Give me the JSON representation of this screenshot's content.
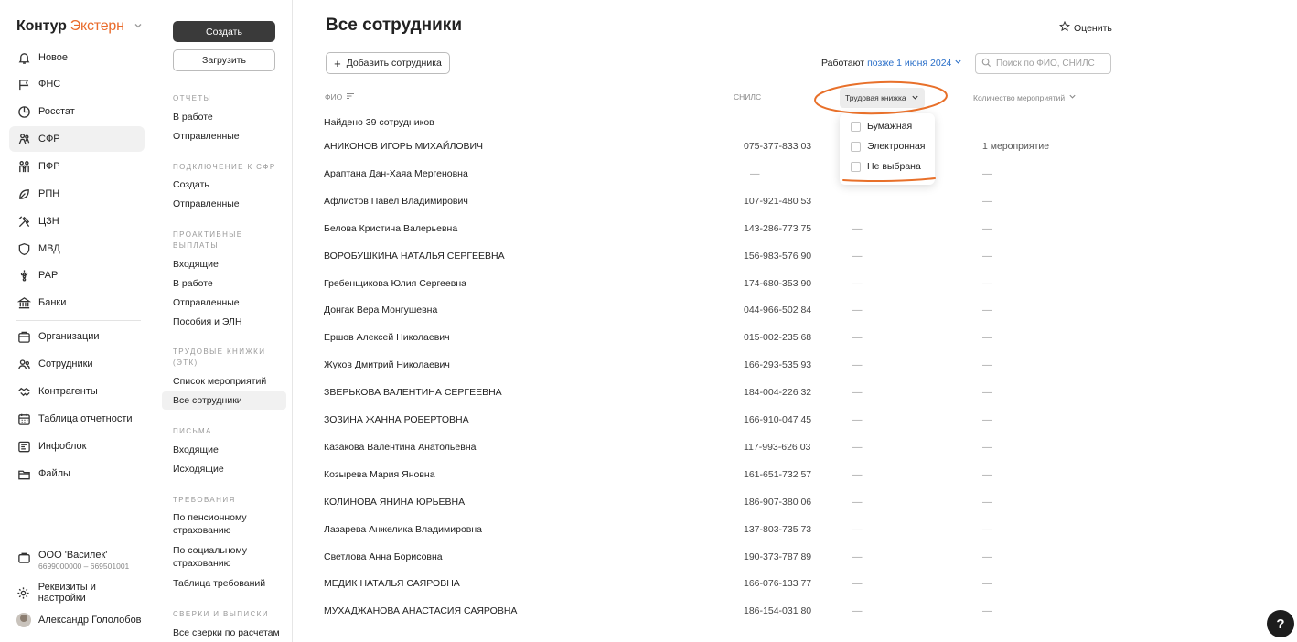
{
  "brand": {
    "part1": "Контур",
    "part2": "Экстерн",
    "chevron": "⌵"
  },
  "nav": {
    "items": [
      {
        "label": "Новое",
        "icon": "bell-icon"
      },
      {
        "label": "ФНС",
        "icon": "flag-icon"
      },
      {
        "label": "Росстат",
        "icon": "chart-circle-icon"
      },
      {
        "label": "СФР",
        "icon": "people-icon"
      },
      {
        "label": "ПФР",
        "icon": "family-icon"
      },
      {
        "label": "РПН",
        "icon": "leaf-icon"
      },
      {
        "label": "ЦЗН",
        "icon": "tools-icon"
      },
      {
        "label": "МВД",
        "icon": "shield-icon"
      },
      {
        "label": "РАР",
        "icon": "grapes-icon"
      },
      {
        "label": "Банки",
        "icon": "bank-icon"
      },
      {
        "label": "Организации",
        "icon": "building-icon"
      },
      {
        "label": "Сотрудники",
        "icon": "users-icon"
      },
      {
        "label": "Контрагенты",
        "icon": "handshake-icon"
      },
      {
        "label": "Таблица отчетности",
        "icon": "calendar-icon"
      },
      {
        "label": "Инфоблок",
        "icon": "news-icon"
      },
      {
        "label": "Файлы",
        "icon": "folder-icon"
      }
    ],
    "org": {
      "name": "ООО 'Василек'",
      "inn": "6699000000 – 669501001"
    },
    "settings": "Реквизиты и настройки",
    "user": "Александр Гололобов"
  },
  "side": {
    "create": "Создать",
    "upload": "Загрузить",
    "sections": [
      {
        "title": "ОТЧЕТЫ",
        "links": [
          "В работе",
          "Отправленные"
        ]
      },
      {
        "title": "ПОДКЛЮЧЕНИЕ К СФР",
        "links": [
          "Создать",
          "Отправленные"
        ]
      },
      {
        "title": "ПРОАКТИВНЫЕ ВЫПЛАТЫ",
        "links": [
          "Входящие",
          "В работе",
          "Отправленные",
          "Пособия и ЭЛН"
        ]
      },
      {
        "title": "ТРУДОВЫЕ КНИЖКИ (ЭТК)",
        "links": [
          "Список мероприятий",
          "Все сотрудники"
        ]
      },
      {
        "title": "ПИСЬМА",
        "links": [
          "Входящие",
          "Исходящие"
        ]
      },
      {
        "title": "ТРЕБОВАНИЯ",
        "links": [
          "По пенсионному страхованию",
          "По социальному страхованию",
          "Таблица требований"
        ]
      },
      {
        "title": "СВЕРКИ И ВЫПИСКИ",
        "links": [
          "Все сверки по расчетам"
        ]
      }
    ]
  },
  "main": {
    "title": "Все сотрудники",
    "rate": "Оценить",
    "add_button": "Добавить сотрудника",
    "works_label": "Работают",
    "works_value": "позже 1 июня 2024",
    "search_placeholder": "Поиск по ФИО, СНИЛС",
    "columns": {
      "fio": "ФИО",
      "snils": "СНИЛС",
      "tk": "Трудовая книжка",
      "events": "Количество мероприятий"
    },
    "found": "Найдено 39 сотрудников",
    "dropdown": [
      "Бумажная",
      "Электронная",
      "Не выбрана"
    ],
    "rows": [
      {
        "name": "АНИКОНОВ ИГОРЬ МИХАЙЛОВИЧ",
        "snils": "075-377-833 03",
        "tk": "",
        "events": "1 мероприятие"
      },
      {
        "name": "Араптана Дан-Хаяа Мергеновна",
        "snils": "—",
        "tk": "",
        "events": "—"
      },
      {
        "name": "Афлистов Павел Владимирович",
        "snils": "107-921-480 53",
        "tk": "",
        "events": "—"
      },
      {
        "name": "Белова Кристина Валерьевна",
        "snils": "143-286-773 75",
        "tk": "—",
        "events": "—"
      },
      {
        "name": "ВОРОБУШКИНА НАТАЛЬЯ СЕРГЕЕВНА",
        "snils": "156-983-576 90",
        "tk": "—",
        "events": "—"
      },
      {
        "name": "Гребенщикова Юлия Сергеевна",
        "snils": "174-680-353 90",
        "tk": "—",
        "events": "—"
      },
      {
        "name": "Донгак Вера Монгушевна",
        "snils": "044-966-502 84",
        "tk": "—",
        "events": "—"
      },
      {
        "name": "Ершов Алексей Николаевич",
        "snils": "015-002-235 68",
        "tk": "—",
        "events": "—"
      },
      {
        "name": "Жуков Дмитрий Николаевич",
        "snils": "166-293-535 93",
        "tk": "—",
        "events": "—"
      },
      {
        "name": "ЗВЕРЬКОВА ВАЛЕНТИНА СЕРГЕЕВНА",
        "snils": "184-004-226 32",
        "tk": "—",
        "events": "—"
      },
      {
        "name": "ЗОЗИНА ЖАННА РОБЕРТОВНА",
        "snils": "166-910-047 45",
        "tk": "—",
        "events": "—"
      },
      {
        "name": "Казакова Валентина Анатольевна",
        "snils": "117-993-626 03",
        "tk": "—",
        "events": "—"
      },
      {
        "name": "Козырева Мария Яновна",
        "snils": "161-651-732 57",
        "tk": "—",
        "events": "—"
      },
      {
        "name": "КОЛИНОВА ЯНИНА ЮРЬЕВНА",
        "snils": "186-907-380 06",
        "tk": "—",
        "events": "—"
      },
      {
        "name": "Лазарева Анжелика Владимировна",
        "snils": "137-803-735 73",
        "tk": "—",
        "events": "—"
      },
      {
        "name": "Светлова Анна Борисовна",
        "snils": "190-373-787 89",
        "tk": "—",
        "events": "—"
      },
      {
        "name": "МЕДИК НАТАЛЬЯ САЯРОВНА",
        "snils": "166-076-133 77",
        "tk": "—",
        "events": "—"
      },
      {
        "name": "МУХАДЖАНОВА АНАСТАСИЯ САЯРОВНА",
        "snils": "186-154-031 80",
        "tk": "—",
        "events": "—"
      }
    ]
  },
  "help": "?",
  "colors": {
    "accent": "#e96b2b",
    "link": "#2a6fc9",
    "dark_button": "#3a3a3a",
    "annotation": "#e8702a"
  }
}
